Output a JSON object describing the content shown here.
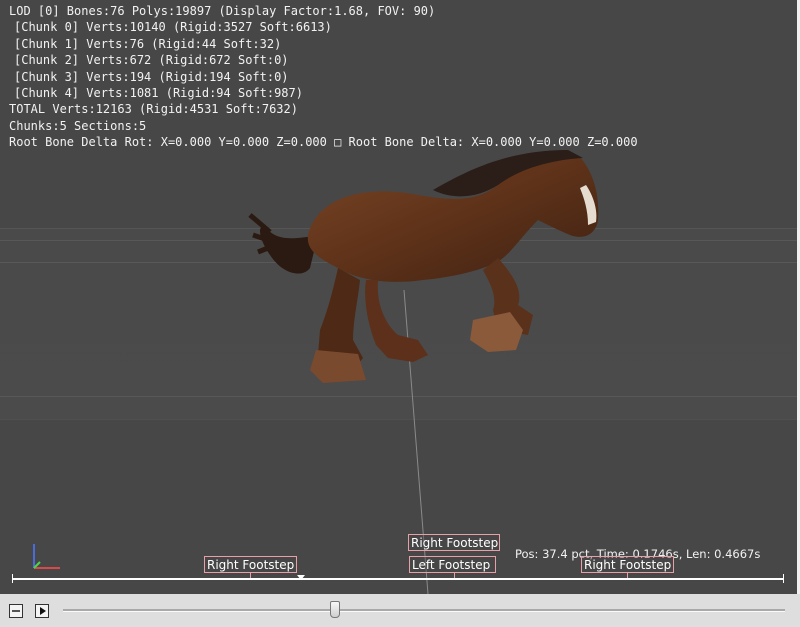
{
  "stats": {
    "line_lod": "LOD [0] Bones:76 Polys:19897 (Display Factor:1.68, FOV: 90)",
    "chunks": [
      "[Chunk 0] Verts:10140 (Rigid:3527 Soft:6613)",
      "[Chunk 1] Verts:76 (Rigid:44 Soft:32)",
      "[Chunk 2] Verts:672 (Rigid:672 Soft:0)",
      "[Chunk 3] Verts:194 (Rigid:194 Soft:0)",
      "[Chunk 4] Verts:1081 (Rigid:94 Soft:987)"
    ],
    "line_total": "TOTAL Verts:12163 (Rigid:4531 Soft:7632)",
    "line_sections": "Chunks:5 Sections:5",
    "line_root": "Root Bone Delta Rot: X=0.000 Y=0.000 Z=0.000 □ Root Bone Delta: X=0.000 Y=0.000 Z=0.000"
  },
  "notifies": [
    {
      "label": "Right Footstep"
    },
    {
      "label": "Right Footstep"
    },
    {
      "label": "Left Footstep"
    },
    {
      "label": "Right Footstep"
    }
  ],
  "playback": {
    "readout": "Pos: 37.4 pct, Time: 0.1746s, Len: 0.4667s",
    "position_fraction": 0.374
  },
  "controls": {
    "loop_icon": "minus-box-icon",
    "play_icon": "play-icon"
  },
  "colors": {
    "viewport_bg": "#474747",
    "notify_border": "#e8a0a8",
    "horse_body": "#6b3a1f"
  }
}
